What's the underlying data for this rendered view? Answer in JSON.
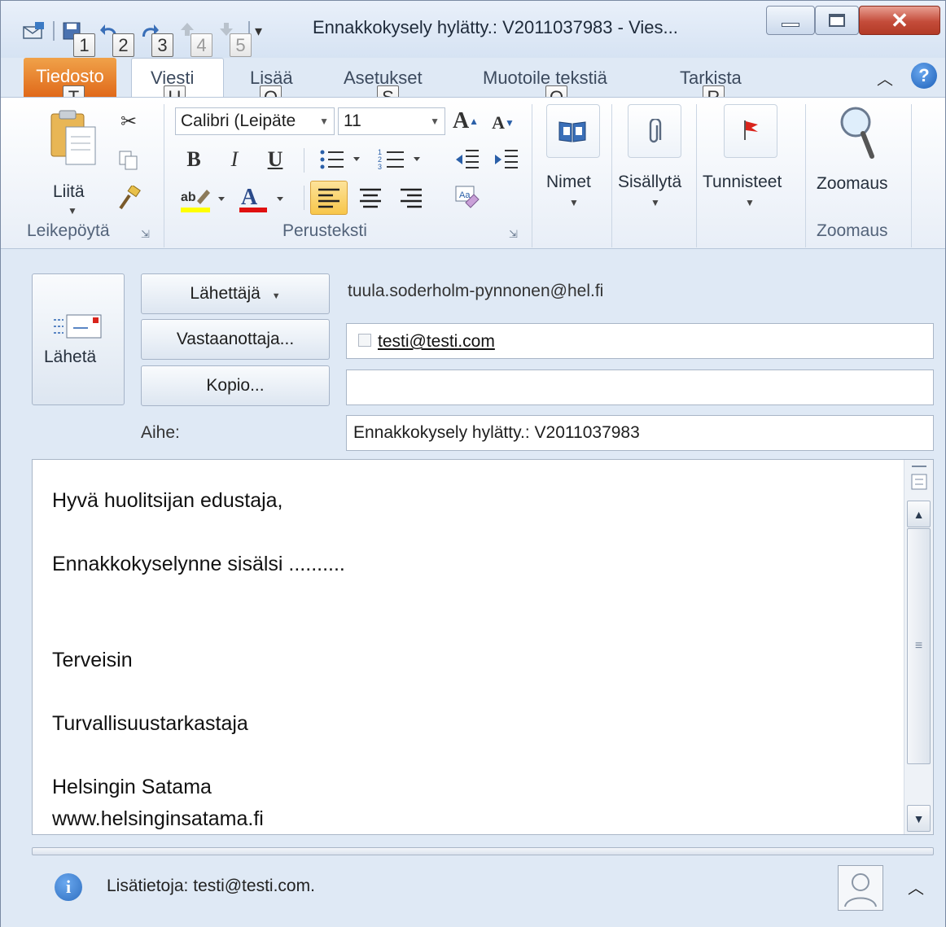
{
  "window": {
    "title": "Ennakkokysely hylätty.: V2011037983 - Vies..."
  },
  "qat_keytips": [
    "1",
    "2",
    "3",
    "4",
    "5"
  ],
  "tabs": {
    "file": "Tiedosto",
    "message": "Viesti",
    "insert": "Lisää",
    "options": "Asetukset",
    "format": "Muotoile tekstiä",
    "review": "Tarkista"
  },
  "tab_keytips": {
    "file": "T",
    "message": "U",
    "insert": "Q",
    "options": "S",
    "format": "O",
    "review": "R"
  },
  "ribbon": {
    "clipboard": {
      "paste_label": "Liitä",
      "group_label": "Leikepöytä"
    },
    "basic_text": {
      "font_name": "Calibri (Leipäte",
      "font_size": "11",
      "group_label": "Perusteksti",
      "bold": "B",
      "italic": "I",
      "underline": "U",
      "font_color_letter": "A"
    },
    "names": {
      "label": "Nimet"
    },
    "include": {
      "label": "Sisällytä"
    },
    "tags": {
      "label": "Tunnisteet"
    },
    "zoom": {
      "label": "Zoomaus",
      "group_label": "Zoomaus"
    }
  },
  "compose": {
    "send_label": "Lähetä",
    "from_label": "Lähettäjä",
    "from_value": "tuula.soderholm-pynnonen@hel.fi",
    "to_label": "Vastaanottaja...",
    "to_value": "testi@testi.com",
    "cc_label": "Kopio...",
    "cc_value": "",
    "subject_label": "Aihe:",
    "subject_value": "Ennakkokysely hylätty.: V2011037983"
  },
  "body_lines": [
    "Hyvä huolitsijan edustaja,",
    "Ennakkokyselynne sisälsi ..........",
    "Terveisin",
    "Turvallisuustarkastaja",
    "Helsingin Satama",
    "www.helsinginsatama.fi"
  ],
  "footer": {
    "info_text": "Lisätietoja: testi@testi.com."
  },
  "colors": {
    "file_tab": "#e0691a",
    "highlight": "#ffff00",
    "font_color": "#e01010",
    "info_icon": "#2f6fc0"
  }
}
